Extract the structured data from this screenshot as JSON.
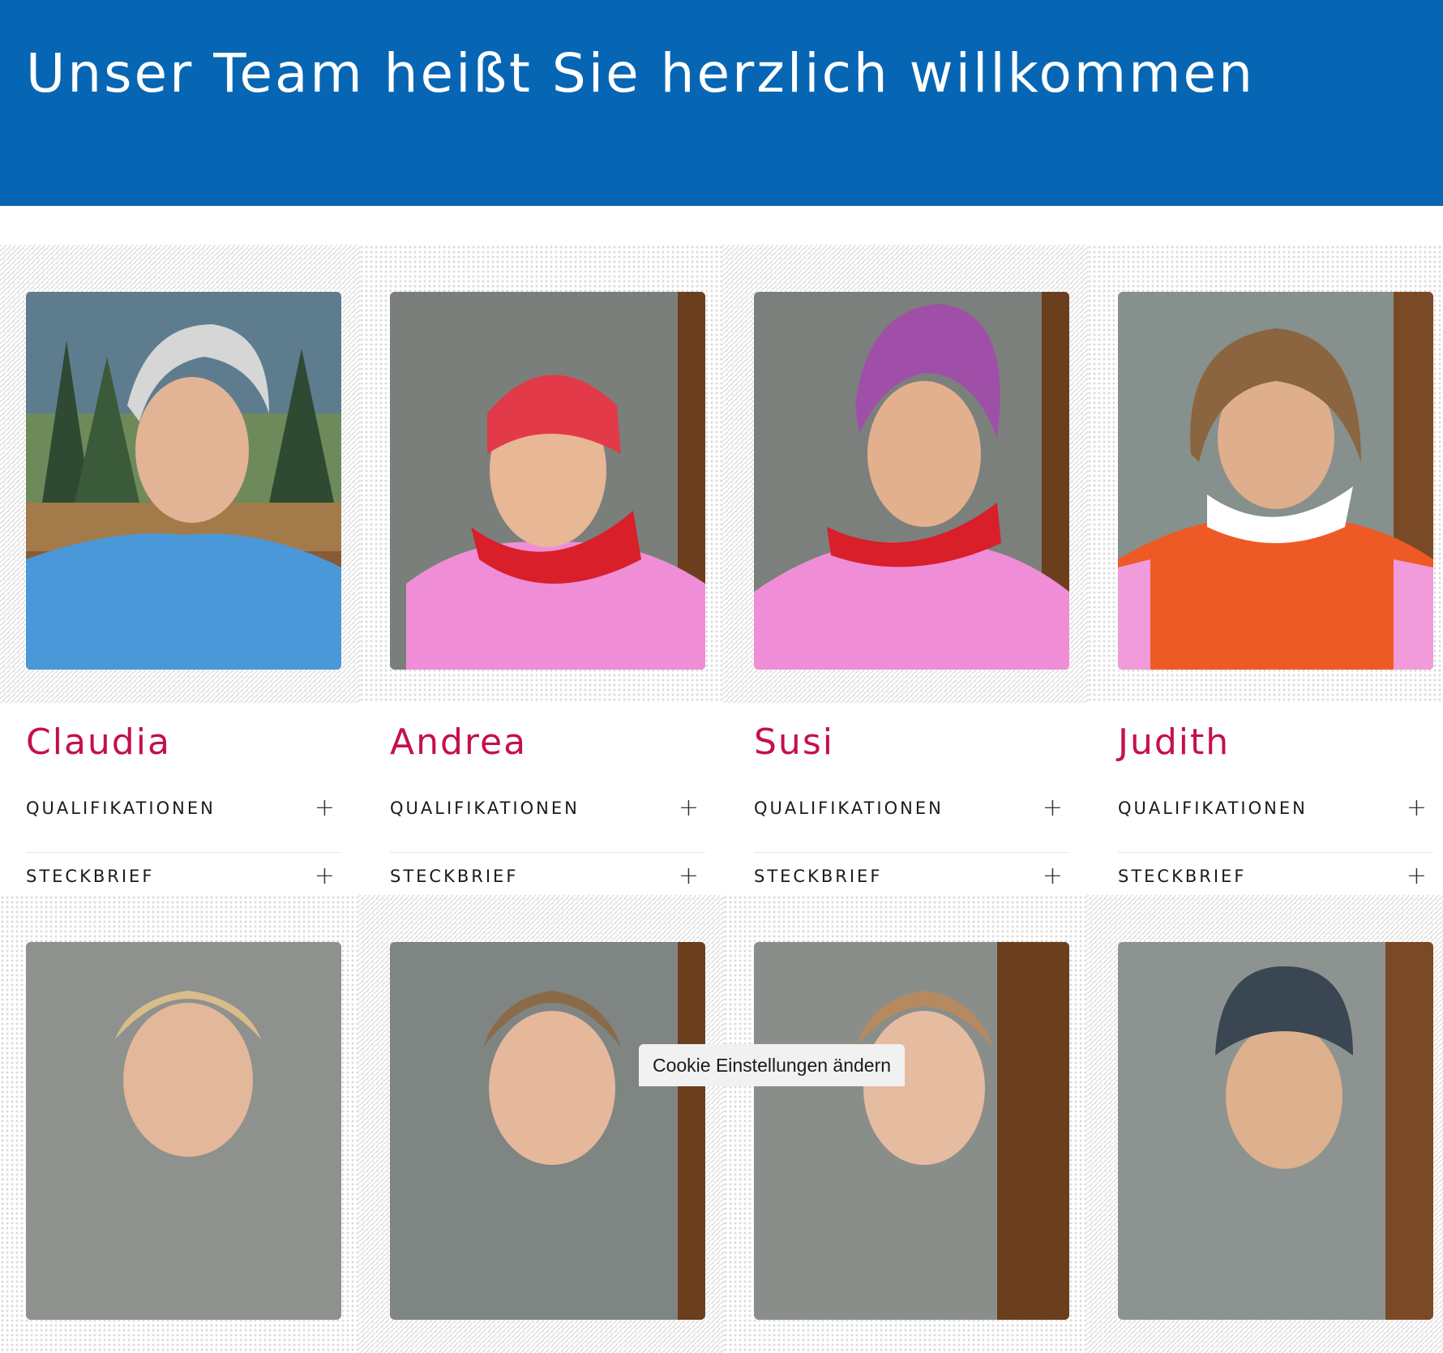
{
  "header": {
    "title": "Unser Team heißt Sie herzlich willkommen"
  },
  "team": [
    {
      "name": "Claudia",
      "qualifikationen": "QUALIFIKATIONEN",
      "steckbrief": "STECKBRIEF"
    },
    {
      "name": "Andrea",
      "qualifikationen": "QUALIFIKATIONEN",
      "steckbrief": "STECKBRIEF"
    },
    {
      "name": "Susi",
      "qualifikationen": "QUALIFIKATIONEN",
      "steckbrief": "STECKBRIEF"
    },
    {
      "name": "Judith",
      "qualifikationen": "QUALIFIKATIONEN",
      "steckbrief": "STECKBRIEF"
    }
  ],
  "accordion_icon": "plus-icon",
  "cookie": {
    "label": "Cookie Einstellungen ändern"
  },
  "colors": {
    "banner": "#0766b4",
    "name": "#c5104c"
  }
}
